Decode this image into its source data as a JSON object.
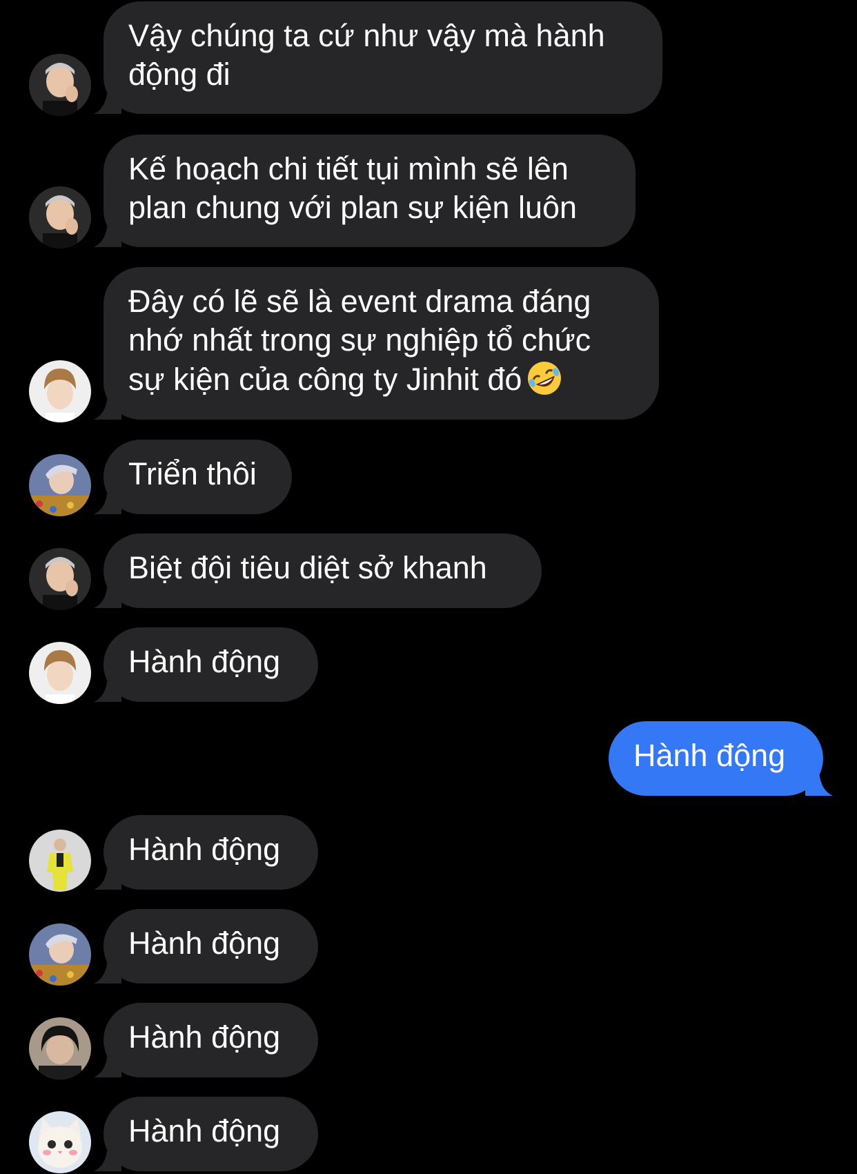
{
  "messages": [
    {
      "sender": "rm",
      "text": "Vậy chúng ta cứ như vậy mà hành\nđộng đi"
    },
    {
      "sender": "rm",
      "text": "Kế hoạch chi tiết tụi mình sẽ lên\nplan chung với plan sự kiện luôn"
    },
    {
      "sender": "jin",
      "text": "Đây có lẽ sẽ là event drama đáng\nnhớ nhất trong sự nghiệp tổ chức\nsự kiện của công ty Jinhit đó",
      "emoji": "rolling-on-floor-laughing-emoji"
    },
    {
      "sender": "jhope",
      "text": "Triển thôi"
    },
    {
      "sender": "rm",
      "text": "Biệt đội tiêu diệt sở khanh"
    },
    {
      "sender": "jin",
      "text": "Hành động"
    },
    {
      "sender": "me",
      "text": "Hành động"
    },
    {
      "sender": "yellow-suit",
      "text": "Hành động"
    },
    {
      "sender": "jhope",
      "text": "Hành động"
    },
    {
      "sender": "dark-hair",
      "text": "Hành động"
    },
    {
      "sender": "cat",
      "text": "Hành động"
    }
  ],
  "colors": {
    "background": "#000000",
    "received_bubble": "#262628",
    "sent_bubble": "#3478f6",
    "text": "#ffffff"
  }
}
